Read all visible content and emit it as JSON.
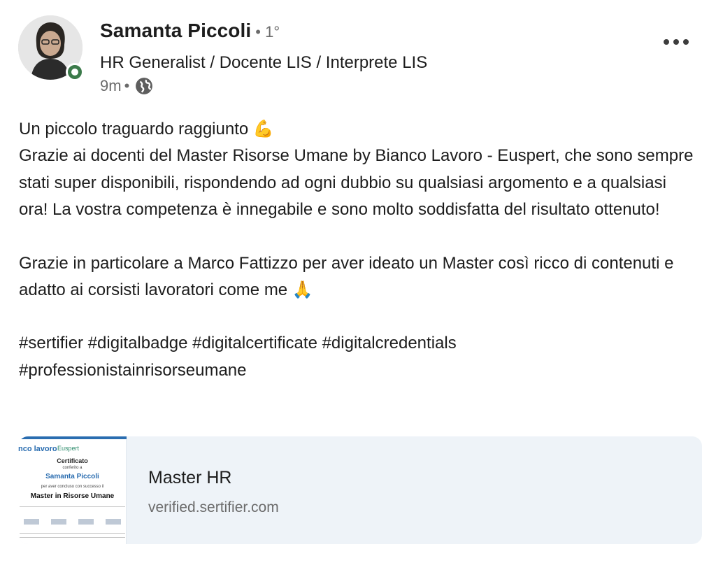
{
  "author": {
    "name": "Samanta Piccoli",
    "degree": "• 1°",
    "headline": "HR Generalist / Docente LIS / Interprete LIS",
    "time": "9m",
    "meta_separator": "•",
    "visibility_icon": "globe-icon",
    "presence_color": "#3b7a4a"
  },
  "menu": {
    "icon": "more-options-icon"
  },
  "post": {
    "line1": "Un piccolo traguardo raggiunto 💪",
    "paragraph1": "Grazie ai docenti del Master Risorse Umane by Bianco Lavoro - Euspert, che sono sempre stati super disponibili, rispondendo ad ogni dubbio su qualsiasi argomento e a qualsiasi ora! La vostra competenza è innegabile e sono molto soddisfatta del risultato ottenuto!",
    "paragraph2": "Grazie in particolare a Marco Fattizzo per aver ideato un Master così ricco di contenuti e adatto ai corsisti lavoratori come me 🙏",
    "hashtags_line1": "#sertifier #digitalbadge #digitalcertificate #digitalcredentials",
    "hashtags_line2": "#professionistainrisorseumane"
  },
  "link_card": {
    "title": "Master HR",
    "url": "verified.sertifier.com",
    "thumbnail": {
      "logo_left": "nco lavoro",
      "logo_right": "Euspert",
      "heading": "Certificato",
      "conferred": "conferito a",
      "recipient": "Samanta Piccoli",
      "completed": "per aver concluso con successo il",
      "course": "Master in Risorse Umane"
    }
  }
}
